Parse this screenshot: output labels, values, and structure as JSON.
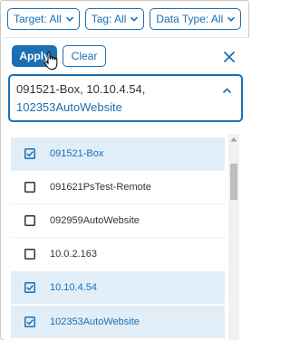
{
  "filters": [
    {
      "label": "Target: All"
    },
    {
      "label": "Tag: All"
    },
    {
      "label": "Data Type: All"
    }
  ],
  "panel": {
    "apply_label": "Apply",
    "clear_label": "Clear"
  },
  "select": {
    "line1": "091521-Box, 10.10.4.54,",
    "line2": "102353AutoWebsite"
  },
  "options": [
    {
      "label": "091521-Box",
      "checked": true
    },
    {
      "label": "091621PsTest-Remote",
      "checked": false
    },
    {
      "label": "092959AutoWebsite",
      "checked": false
    },
    {
      "label": "10.0.2.163",
      "checked": false
    },
    {
      "label": "10.10.4.54",
      "checked": true
    },
    {
      "label": "102353AutoWebsite",
      "checked": true
    }
  ],
  "colors": {
    "accent": "#1b6fb3",
    "selected_row": "#e1eef8"
  },
  "icons": {
    "filter_chevron": "chevron-down-icon",
    "close": "close-icon",
    "select_caret": "chevron-up-icon",
    "checkbox_checked": "checkbox-checked-icon",
    "checkbox_unchecked": "checkbox-unchecked-icon"
  }
}
